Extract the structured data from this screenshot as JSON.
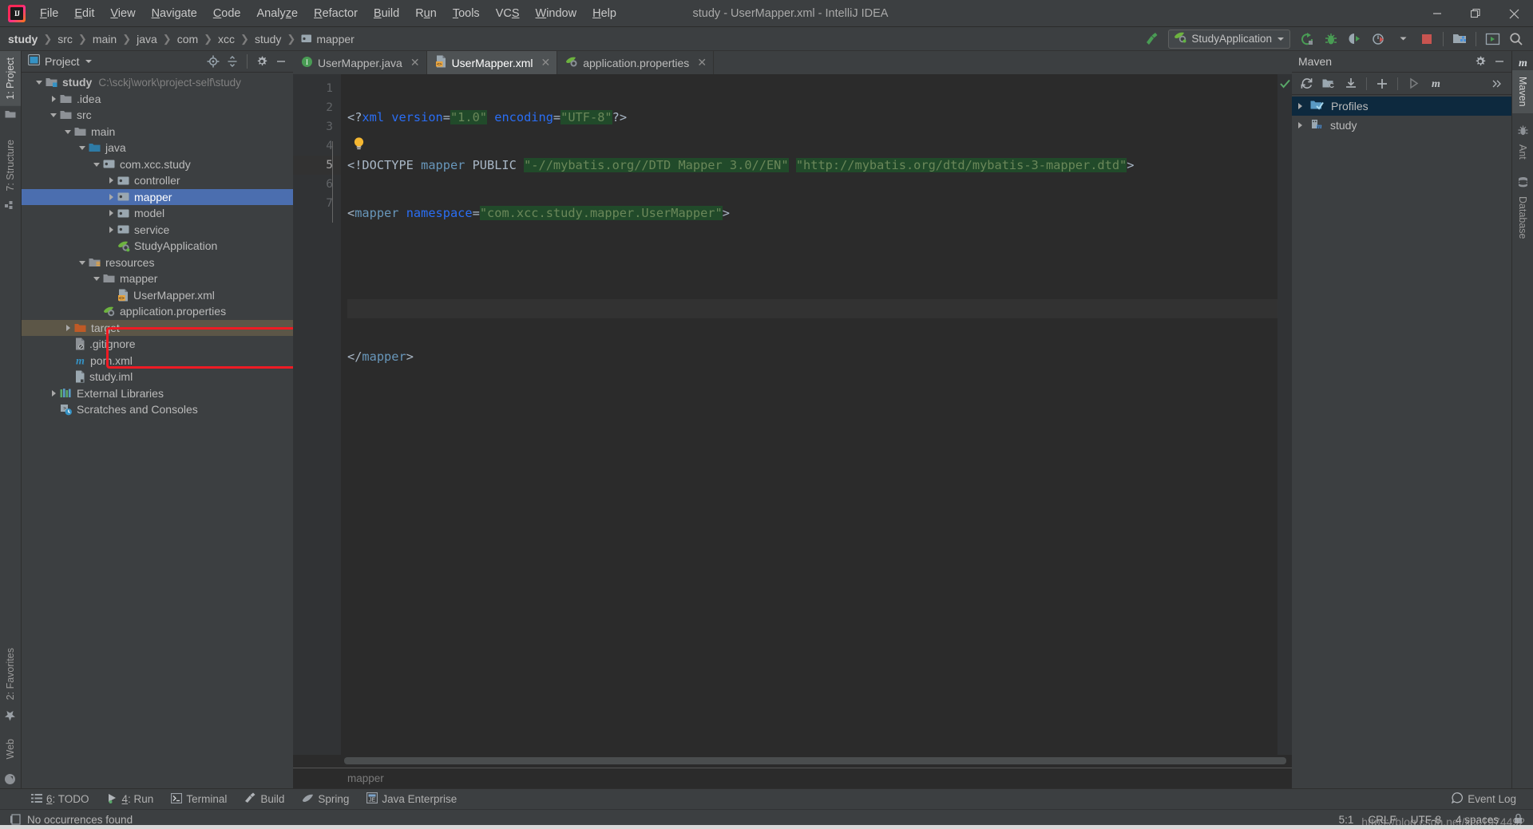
{
  "window": {
    "title": "study - UserMapper.xml - IntelliJ IDEA",
    "minimize_label": "Minimize",
    "maximize_label": "Restore",
    "close_label": "Close"
  },
  "menu": [
    {
      "label": "File",
      "mnemonic": "F"
    },
    {
      "label": "Edit",
      "mnemonic": "E"
    },
    {
      "label": "View",
      "mnemonic": "V"
    },
    {
      "label": "Navigate",
      "mnemonic": "N"
    },
    {
      "label": "Code",
      "mnemonic": "C"
    },
    {
      "label": "Analyze",
      "mnemonic": "z"
    },
    {
      "label": "Refactor",
      "mnemonic": "R"
    },
    {
      "label": "Build",
      "mnemonic": "B"
    },
    {
      "label": "Run",
      "mnemonic": "u"
    },
    {
      "label": "Tools",
      "mnemonic": "T"
    },
    {
      "label": "VCS",
      "mnemonic": "S"
    },
    {
      "label": "Window",
      "mnemonic": "W"
    },
    {
      "label": "Help",
      "mnemonic": "H"
    }
  ],
  "breadcrumbs": [
    "study",
    "src",
    "main",
    "java",
    "com",
    "xcc",
    "study",
    "mapper"
  ],
  "toolbar": {
    "build_hammer": "build-icon",
    "run_config_name": "StudyApplication",
    "run_label": "Run",
    "debug_label": "Debug",
    "run_coverage_label": "Run with Coverage",
    "profile_label": "Profile",
    "stop_label": "Stop",
    "project_structure_label": "Project Structure",
    "update_label": "Update Project",
    "search_label": "Search Everywhere"
  },
  "left_strip": [
    {
      "label": "1: Project",
      "num": "1",
      "active": true
    },
    {
      "label": "7: Structure",
      "num": "7",
      "active": false
    },
    {
      "label": "2: Favorites",
      "num": "2",
      "active": false
    },
    {
      "label": "Web",
      "num": "",
      "active": false
    }
  ],
  "right_strip": [
    {
      "label": "Maven",
      "active": true
    },
    {
      "label": "Ant",
      "active": false
    },
    {
      "label": "Database",
      "active": false
    }
  ],
  "project_panel": {
    "title": "Project",
    "locate_label": "Select Opened File",
    "collapse_label": "Collapse All",
    "settings_label": "Settings",
    "hide_label": "Hide",
    "tree": [
      {
        "label": "study",
        "path": "C:\\sckj\\work\\project-self\\study",
        "indent": 0,
        "arrow": "down",
        "icon": "module-folder",
        "bold": true,
        "state": "none"
      },
      {
        "label": ".idea",
        "path": "",
        "indent": 1,
        "arrow": "right",
        "icon": "folder",
        "bold": false,
        "state": "none"
      },
      {
        "label": "src",
        "path": "",
        "indent": 1,
        "arrow": "down",
        "icon": "folder",
        "bold": false,
        "state": "none"
      },
      {
        "label": "main",
        "path": "",
        "indent": 2,
        "arrow": "down",
        "icon": "folder",
        "bold": false,
        "state": "none"
      },
      {
        "label": "java",
        "path": "",
        "indent": 3,
        "arrow": "down",
        "icon": "source-folder",
        "bold": false,
        "state": "none"
      },
      {
        "label": "com.xcc.study",
        "path": "",
        "indent": 4,
        "arrow": "down",
        "icon": "package",
        "bold": false,
        "state": "none"
      },
      {
        "label": "controller",
        "path": "",
        "indent": 5,
        "arrow": "right",
        "icon": "package",
        "bold": false,
        "state": "none"
      },
      {
        "label": "mapper",
        "path": "",
        "indent": 5,
        "arrow": "right",
        "icon": "package",
        "bold": false,
        "state": "selected"
      },
      {
        "label": "model",
        "path": "",
        "indent": 5,
        "arrow": "right",
        "icon": "package",
        "bold": false,
        "state": "none"
      },
      {
        "label": "service",
        "path": "",
        "indent": 5,
        "arrow": "right",
        "icon": "package",
        "bold": false,
        "state": "none"
      },
      {
        "label": "StudyApplication",
        "path": "",
        "indent": 5,
        "arrow": "none",
        "icon": "spring-class",
        "bold": false,
        "state": "none"
      },
      {
        "label": "resources",
        "path": "",
        "indent": 3,
        "arrow": "down",
        "icon": "resource-folder",
        "bold": false,
        "state": "none"
      },
      {
        "label": "mapper",
        "path": "",
        "indent": 4,
        "arrow": "down",
        "icon": "folder",
        "bold": false,
        "state": "none"
      },
      {
        "label": "UserMapper.xml",
        "path": "",
        "indent": 5,
        "arrow": "none",
        "icon": "xml-file",
        "bold": false,
        "state": "none"
      },
      {
        "label": "application.properties",
        "path": "",
        "indent": 4,
        "arrow": "none",
        "icon": "spring-properties",
        "bold": false,
        "state": "none"
      },
      {
        "label": "target",
        "path": "",
        "indent": 2,
        "arrow": "right",
        "icon": "excluded-folder",
        "bold": false,
        "state": "target"
      },
      {
        "label": ".gitignore",
        "path": "",
        "indent": 2,
        "arrow": "none",
        "icon": "gitignore-file",
        "bold": false,
        "state": "none"
      },
      {
        "label": "pom.xml",
        "path": "",
        "indent": 2,
        "arrow": "none",
        "icon": "maven-file",
        "bold": false,
        "state": "none"
      },
      {
        "label": "study.iml",
        "path": "",
        "indent": 2,
        "arrow": "none",
        "icon": "iml-file",
        "bold": false,
        "state": "none"
      },
      {
        "label": "External Libraries",
        "path": "",
        "indent": 1,
        "arrow": "right",
        "icon": "libraries",
        "bold": false,
        "state": "none"
      },
      {
        "label": "Scratches and Consoles",
        "path": "",
        "indent": 1,
        "arrow": "none",
        "icon": "scratches",
        "bold": false,
        "state": "none"
      }
    ],
    "annotation": {
      "color": "#ee1b24",
      "shape": "rectangle",
      "target": "mapper / UserMapper.xml"
    }
  },
  "editor": {
    "tabs": [
      {
        "label": "UserMapper.java",
        "icon": "interface-icon",
        "active": false
      },
      {
        "label": "UserMapper.xml",
        "icon": "xml-file-icon",
        "active": true
      },
      {
        "label": "application.properties",
        "icon": "spring-properties-icon",
        "active": false
      }
    ],
    "line_numbers": [
      "1",
      "2",
      "3",
      "4",
      "5",
      "6",
      "7"
    ],
    "caret_line": 5,
    "lines": [
      {
        "n": 1,
        "tokens": [
          {
            "t": "<?",
            "c": "punct"
          },
          {
            "t": "xml ",
            "c": "proc"
          },
          {
            "t": "version",
            "c": "attr"
          },
          {
            "t": "=",
            "c": "punct"
          },
          {
            "t": "\"1.0\"",
            "c": "val"
          },
          {
            "t": " ",
            "c": "plain"
          },
          {
            "t": "encoding",
            "c": "attr"
          },
          {
            "t": "=",
            "c": "punct"
          },
          {
            "t": "\"UTF-8\"",
            "c": "val"
          },
          {
            "t": "?>",
            "c": "punct"
          }
        ]
      },
      {
        "n": 2,
        "tokens": [
          {
            "t": "<!DOCTYPE ",
            "c": "plain"
          },
          {
            "t": "mapper",
            "c": "dtdkw"
          },
          {
            "t": " PUBLIC ",
            "c": "plain"
          },
          {
            "t": "\"-//mybatis.org//DTD Mapper 3.0//EN\"",
            "c": "val"
          },
          {
            "t": " ",
            "c": "plain"
          },
          {
            "t": "\"http://mybatis.org/dtd/mybatis-3-mapper.dtd\"",
            "c": "val"
          },
          {
            "t": ">",
            "c": "plain"
          }
        ]
      },
      {
        "n": 3,
        "tokens": [
          {
            "t": "<",
            "c": "punct"
          },
          {
            "t": "mapper",
            "c": "tagname"
          },
          {
            "t": " ",
            "c": "plain"
          },
          {
            "t": "namespace",
            "c": "attr2"
          },
          {
            "t": "=",
            "c": "punct"
          },
          {
            "t": "\"com.xcc.study.mapper.UserMapper\"",
            "c": "val"
          },
          {
            "t": ">",
            "c": "punct"
          }
        ]
      },
      {
        "n": 4,
        "tokens": []
      },
      {
        "n": 5,
        "tokens": []
      },
      {
        "n": 6,
        "tokens": [
          {
            "t": "</",
            "c": "punct"
          },
          {
            "t": "mapper",
            "c": "tagname"
          },
          {
            "t": ">",
            "c": "punct"
          }
        ]
      },
      {
        "n": 7,
        "tokens": []
      }
    ],
    "intention_bulb": "lightbulb-icon",
    "inspection_status": "ok",
    "breadcrumb": "mapper"
  },
  "maven_panel": {
    "title": "Maven",
    "settings_label": "Settings",
    "hide_label": "Hide",
    "toolbar": {
      "reimport_label": "Reimport All Maven Projects",
      "generate_sources_label": "Generate Sources and Update Folders",
      "download_label": "Download Sources",
      "add_label": "Add Maven Project",
      "run_label": "Run Maven Build",
      "execute_goal_label": "Execute Maven Goal",
      "more_label": "More"
    },
    "tree": [
      {
        "label": "Profiles",
        "icon": "profiles-icon",
        "arrow": "right",
        "selected": true
      },
      {
        "label": "study",
        "icon": "maven-module-icon",
        "arrow": "right",
        "selected": false
      }
    ]
  },
  "bottom_strip": [
    {
      "label": "6: TODO",
      "num": "6",
      "icon": "todo-icon"
    },
    {
      "label": "4: Run",
      "num": "4",
      "icon": "run-icon"
    },
    {
      "label": "Terminal",
      "num": "",
      "icon": "terminal-icon"
    },
    {
      "label": "Build",
      "num": "",
      "icon": "build-icon"
    },
    {
      "label": "Spring",
      "num": "",
      "icon": "spring-icon"
    },
    {
      "label": "Java Enterprise",
      "num": "",
      "icon": "java-ee-icon"
    }
  ],
  "event_log": {
    "label": "Event Log",
    "icon": "event-log-icon"
  },
  "statusbar": {
    "message": "No occurrences found",
    "caret_position": "5:1",
    "line_separator": "CRLF",
    "encoding": "UTF-8",
    "indent": "4 spaces",
    "lock_icon": "lock-icon",
    "watermark": "https://blog.csdn.net/xcc1974492"
  }
}
